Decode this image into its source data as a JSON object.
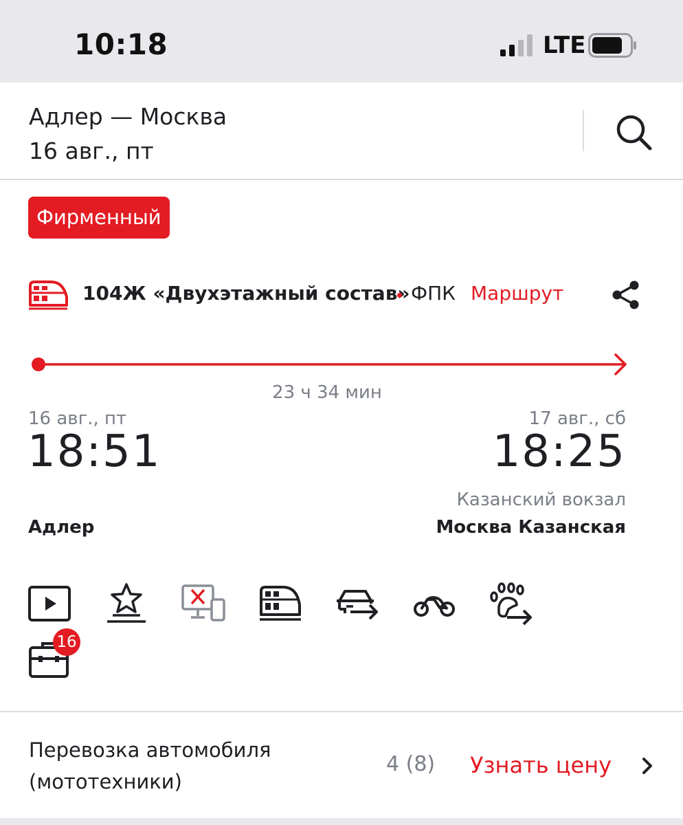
{
  "status_bar": {
    "time": "10:18",
    "network": "LTE",
    "signal_bars": 2,
    "signal_bars_total": 4,
    "battery_level": 0.7
  },
  "header": {
    "route": "Адлер — Москва",
    "date": "16 авг., пт",
    "search_icon": "search-icon"
  },
  "train": {
    "badge": "Фирменный",
    "name": "104Ж «Двухэтажный состав»",
    "carrier": "ФПК",
    "route_link": "Маршрут",
    "train_icon": "double-decker-train-icon",
    "share_icon": "share-icon"
  },
  "trip": {
    "duration": "23 ч 34 мин",
    "departure": {
      "date": "16 авг., пт",
      "time": "18:51",
      "city": "Адлер"
    },
    "arrival": {
      "date": "17 авг., сб",
      "time": "18:25",
      "station": "Казанский вокзал",
      "city": "Москва Казанская"
    }
  },
  "amenities": [
    {
      "icon": "video-play-icon"
    },
    {
      "icon": "star-award-icon"
    },
    {
      "icon": "no-devices-icon"
    },
    {
      "icon": "double-decker-train-icon"
    },
    {
      "icon": "car-transport-icon"
    },
    {
      "icon": "motorcycle-icon"
    },
    {
      "icon": "pet-transport-icon"
    },
    {
      "icon": "luggage-icon",
      "badge": "16"
    }
  ],
  "car_transport": {
    "title": "Перевозка автомобиля (мототехники)",
    "count": "4 (8)",
    "price_link": "Узнать цену"
  },
  "colors": {
    "accent": "#e31b23",
    "text": "#1f1f24",
    "muted": "#7a7e87",
    "statusbar_bg": "#e9e9ed"
  }
}
